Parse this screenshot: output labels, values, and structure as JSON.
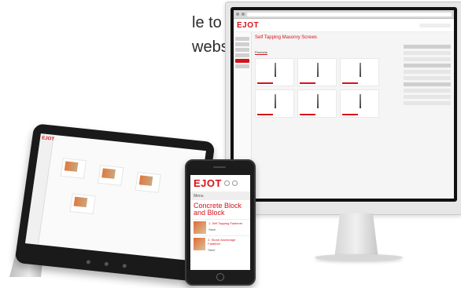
{
  "intro": {
    "line1": "le to buy online.",
    "line2": "webshop account."
  },
  "monitor": {
    "logo": "EJOT",
    "page_title": "Self Tapping Masonry Screws",
    "tab": "Products"
  },
  "tablet": {
    "logo": "EJOT"
  },
  "phone": {
    "logo": "EJOT",
    "nav": "Menu",
    "title_line1": "Concrete Block",
    "title_line2": "and Block",
    "item1": "1. Self Tapping Fastener",
    "item1_sub": "Steel",
    "item2": "2. Stone Anchorage Fastener",
    "item2_sub": "Steel"
  },
  "colors": {
    "brand_red": "#d5131b"
  }
}
